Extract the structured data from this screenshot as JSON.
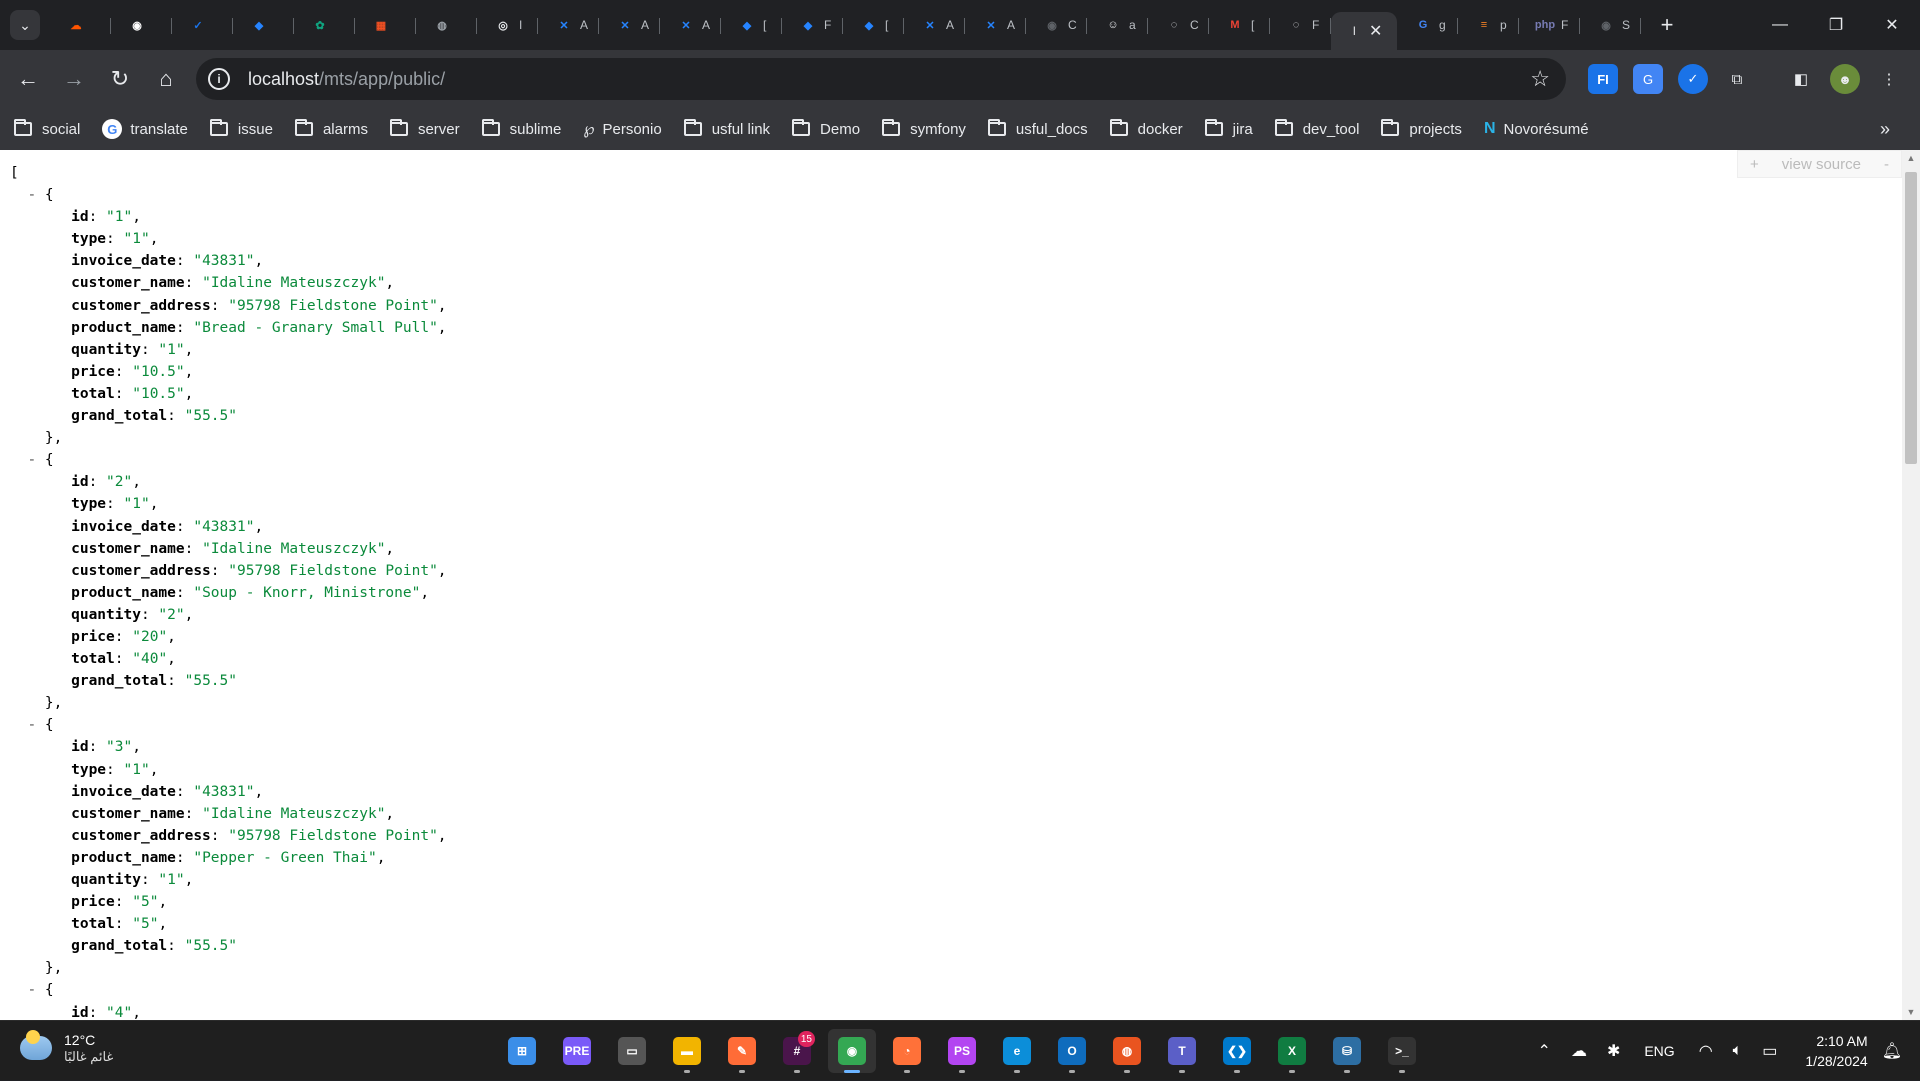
{
  "browser": {
    "tabs": [
      {
        "icon": "soundcloud-icon",
        "label": "",
        "color": "#ff5500",
        "glyph": "☁"
      },
      {
        "icon": "github-icon",
        "label": "",
        "color": "#ffffff",
        "glyph": "◉"
      },
      {
        "icon": "task-check-icon",
        "label": "",
        "color": "#1a73e8",
        "glyph": "✓"
      },
      {
        "icon": "jira-icon",
        "label": "",
        "color": "#2684ff",
        "glyph": "◆"
      },
      {
        "icon": "chatgpt-icon",
        "label": "",
        "color": "#10a37f",
        "glyph": "✿"
      },
      {
        "icon": "microsoft-icon",
        "label": "",
        "color": "#f25022",
        "glyph": "▦"
      },
      {
        "icon": "globe-icon",
        "label": "",
        "color": "#9aa0a6",
        "glyph": "◍"
      },
      {
        "icon": "ring-icon",
        "label": "I",
        "color": "#e8eaed",
        "glyph": "◎"
      },
      {
        "icon": "confluence-icon",
        "label": "A",
        "color": "#2684ff",
        "glyph": "✕"
      },
      {
        "icon": "confluence-icon",
        "label": "A",
        "color": "#2684ff",
        "glyph": "✕"
      },
      {
        "icon": "confluence-icon",
        "label": "A",
        "color": "#2684ff",
        "glyph": "✕"
      },
      {
        "icon": "jira-icon",
        "label": "[",
        "color": "#2684ff",
        "glyph": "◆"
      },
      {
        "icon": "jira-icon",
        "label": "F",
        "color": "#2684ff",
        "glyph": "◆"
      },
      {
        "icon": "jira-icon",
        "label": "[",
        "color": "#2684ff",
        "glyph": "◆"
      },
      {
        "icon": "confluence-icon",
        "label": "A",
        "color": "#2684ff",
        "glyph": "✕"
      },
      {
        "icon": "confluence-icon",
        "label": "A",
        "color": "#2684ff",
        "glyph": "✕"
      },
      {
        "icon": "github-icon",
        "label": "C",
        "color": "#5f6368",
        "glyph": "◉"
      },
      {
        "icon": "avatar-icon",
        "label": "a",
        "color": "#e8eaed",
        "glyph": "☺"
      },
      {
        "icon": "loading-icon",
        "label": "C",
        "color": "#e8eaed",
        "glyph": "◌"
      },
      {
        "icon": "gmail-icon",
        "label": "[",
        "color": "#ea4335",
        "glyph": "M"
      },
      {
        "icon": "loading-icon",
        "label": "F",
        "color": "#e8eaed",
        "glyph": "◌"
      }
    ],
    "active_tab": {
      "label": "l"
    },
    "tabs_after": [
      {
        "icon": "google-icon",
        "label": "g",
        "color": "#4285f4",
        "glyph": "G"
      },
      {
        "icon": "stackoverflow-icon",
        "label": "p",
        "color": "#f48024",
        "glyph": "≡"
      },
      {
        "icon": "php-icon",
        "label": "F",
        "color": "#777bb3",
        "glyph": "php"
      },
      {
        "icon": "github-icon",
        "label": "S",
        "color": "#5f6368",
        "glyph": "◉"
      }
    ],
    "url_host": "localhost",
    "url_path": "/mts/app/public/",
    "bookmarks": [
      {
        "type": "folder",
        "label": "social"
      },
      {
        "type": "google",
        "label": "translate"
      },
      {
        "type": "folder",
        "label": "issue"
      },
      {
        "type": "folder",
        "label": "alarms"
      },
      {
        "type": "folder",
        "label": "server"
      },
      {
        "type": "folder",
        "label": "sublime"
      },
      {
        "type": "personio",
        "label": "Personio"
      },
      {
        "type": "folder",
        "label": "usful link"
      },
      {
        "type": "folder",
        "label": "Demo"
      },
      {
        "type": "folder",
        "label": "symfony"
      },
      {
        "type": "folder",
        "label": "usful_docs"
      },
      {
        "type": "folder",
        "label": "docker"
      },
      {
        "type": "folder",
        "label": "jira"
      },
      {
        "type": "folder",
        "label": "dev_tool"
      },
      {
        "type": "folder",
        "label": "projects"
      },
      {
        "type": "novoresume",
        "label": "Novorésumé"
      }
    ]
  },
  "viewer": {
    "view_source_label": "view source",
    "open_bracket": "[",
    "records": [
      {
        "id": "1",
        "type": "1",
        "invoice_date": "43831",
        "customer_name": "Idaline Mateuszczyk",
        "customer_address": "95798 Fieldstone Point",
        "product_name": "Bread - Granary Small Pull",
        "quantity": "1",
        "price": "10.5",
        "total": "10.5",
        "grand_total": "55.5"
      },
      {
        "id": "2",
        "type": "1",
        "invoice_date": "43831",
        "customer_name": "Idaline Mateuszczyk",
        "customer_address": "95798 Fieldstone Point",
        "product_name": "Soup - Knorr, Ministrone",
        "quantity": "2",
        "price": "20",
        "total": "40",
        "grand_total": "55.5"
      },
      {
        "id": "3",
        "type": "1",
        "invoice_date": "43831",
        "customer_name": "Idaline Mateuszczyk",
        "customer_address": "95798 Fieldstone Point",
        "product_name": "Pepper - Green Thai",
        "quantity": "1",
        "price": "5",
        "total": "5",
        "grand_total": "55.5"
      }
    ],
    "partial_record": {
      "id": "4"
    }
  },
  "taskbar": {
    "temperature": "12°C",
    "condition": "غائم غالبًا",
    "language": "ENG",
    "time": "2:10 AM",
    "date": "1/28/2024",
    "slack_badge": "15",
    "apps": [
      {
        "name": "windows-start-icon",
        "bg": "#3b8ee8",
        "glyph": "⊞"
      },
      {
        "name": "copilot-icon",
        "bg": "#7a5af8",
        "glyph": "PRE"
      },
      {
        "name": "task-view-icon",
        "bg": "#555555",
        "glyph": "▭"
      },
      {
        "name": "file-explorer-icon",
        "bg": "#f2b400",
        "glyph": "▬"
      },
      {
        "name": "postman-icon",
        "bg": "#ff6c37",
        "glyph": "✎"
      },
      {
        "name": "slack-icon",
        "bg": "#4a154b",
        "glyph": "#"
      },
      {
        "name": "chrome-icon",
        "bg": "#34a853",
        "glyph": "◉"
      },
      {
        "name": "firefox-icon",
        "bg": "#ff7139",
        "glyph": "◔"
      },
      {
        "name": "phpstorm-icon",
        "bg": "#b345f1",
        "glyph": "PS"
      },
      {
        "name": "edge-icon",
        "bg": "#0c8ed9",
        "glyph": "e"
      },
      {
        "name": "outlook-icon",
        "bg": "#0f6cbd",
        "glyph": "O"
      },
      {
        "name": "ubuntu-icon",
        "bg": "#e95420",
        "glyph": "◍"
      },
      {
        "name": "teams-icon",
        "bg": "#5b5fc7",
        "glyph": "T"
      },
      {
        "name": "vscode-icon",
        "bg": "#007acc",
        "glyph": "❮❯"
      },
      {
        "name": "excel-icon",
        "bg": "#107c41",
        "glyph": "X"
      },
      {
        "name": "mysql-workbench-icon",
        "bg": "#2d6ea3",
        "glyph": "⛁"
      },
      {
        "name": "terminal-icon",
        "bg": "#333333",
        "glyph": ">_"
      }
    ]
  }
}
